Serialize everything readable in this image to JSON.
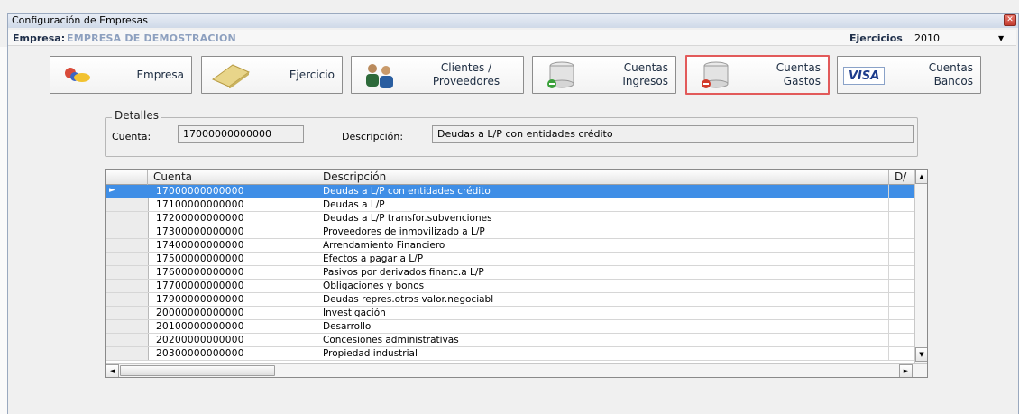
{
  "window": {
    "title": "Configuración de Empresas",
    "close_glyph": "✕"
  },
  "empresa_bar": {
    "empresa_label": "Empresa:",
    "empresa_value": "EMPRESA DE DEMOSTRACION",
    "ejercicios_label": "Ejercicios",
    "ejercicio_value": "2010",
    "dropdown_glyph": "▼"
  },
  "toolbar": {
    "buttons": [
      {
        "label": "Empresa",
        "icon": "company-icon"
      },
      {
        "label": "Ejercicio",
        "icon": "ledger-book-icon"
      },
      {
        "label": "Clientes / Proveedores",
        "icon": "people-icon"
      },
      {
        "label": "Cuentas Ingresos",
        "icon": "database-add-icon"
      },
      {
        "label": "Cuentas Gastos",
        "icon": "database-remove-icon"
      },
      {
        "label": "Cuentas Bancos",
        "icon": "visa-card-icon"
      }
    ],
    "visa_text": "VISA"
  },
  "details": {
    "title": "Detalles",
    "cuenta_label": "Cuenta:",
    "cuenta_value": "17000000000000",
    "descripcion_label": "Descripción:",
    "descripcion_value": "Deudas a L/P con entidades crédito"
  },
  "grid": {
    "columns": [
      "Cuenta",
      "Descripción",
      "D/"
    ],
    "selected_index": 0,
    "row_pointer_glyph": "►",
    "rows": [
      {
        "cuenta": "17000000000000",
        "descripcion": "Deudas a L/P con entidades crédito"
      },
      {
        "cuenta": "17100000000000",
        "descripcion": "Deudas a L/P"
      },
      {
        "cuenta": "17200000000000",
        "descripcion": "Deudas a L/P transfor.subvenciones"
      },
      {
        "cuenta": "17300000000000",
        "descripcion": "Proveedores de inmovilizado a L/P"
      },
      {
        "cuenta": "17400000000000",
        "descripcion": "Arrendamiento Financiero"
      },
      {
        "cuenta": "17500000000000",
        "descripcion": "Efectos a pagar a L/P"
      },
      {
        "cuenta": "17600000000000",
        "descripcion": "Pasivos por derivados financ.a L/P"
      },
      {
        "cuenta": "17700000000000",
        "descripcion": "Obligaciones y bonos"
      },
      {
        "cuenta": "17900000000000",
        "descripcion": "Deudas repres.otros valor.negociabl"
      },
      {
        "cuenta": "20000000000000",
        "descripcion": "Investigación"
      },
      {
        "cuenta": "20100000000000",
        "descripcion": "Desarrollo"
      },
      {
        "cuenta": "20200000000000",
        "descripcion": "Concesiones administrativas"
      },
      {
        "cuenta": "20300000000000",
        "descripcion": "Propiedad industrial"
      }
    ],
    "scroll_up_glyph": "▲",
    "scroll_down_glyph": "▼",
    "scroll_left_glyph": "◄",
    "scroll_right_glyph": "►"
  },
  "colors": {
    "selection": "#3f8ee6",
    "active_button_border": "#e25a5a",
    "empresa_value": "#8da0bf"
  }
}
